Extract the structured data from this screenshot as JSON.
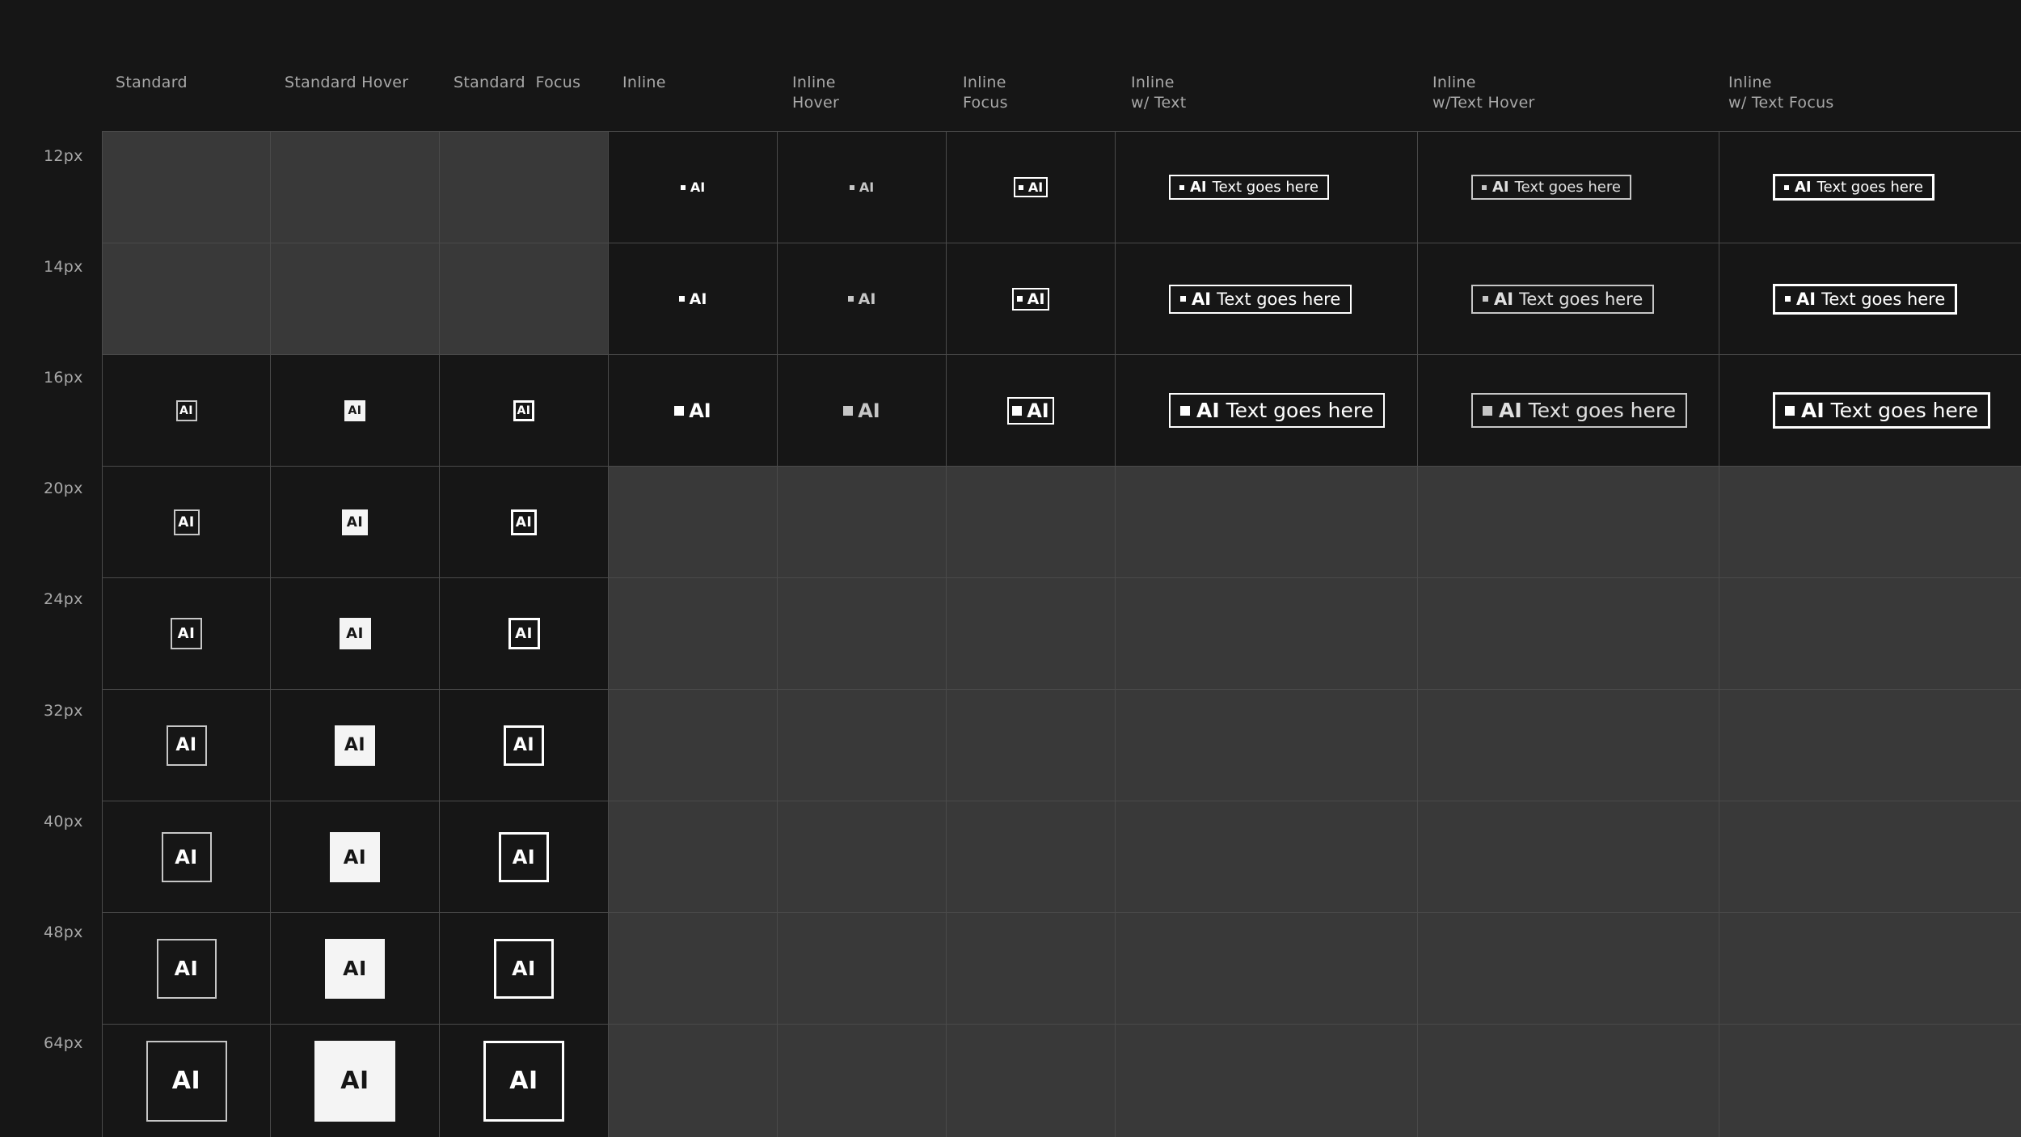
{
  "columns": {
    "standard": "Standard",
    "standard_hover": "Standard Hover",
    "standard_focus": "Standard  Focus",
    "inline": "Inline",
    "inline_hover": "Inline\nHover",
    "inline_focus": "Inline\nFocus",
    "inline_text": "Inline\nw/ Text",
    "inline_text_hover": "Inline\nw/Text Hover",
    "inline_text_focus": "Inline\nw/ Text Focus"
  },
  "rows": {
    "r12": "12px",
    "r14": "14px",
    "r16": "16px",
    "r20": "20px",
    "r24": "24px",
    "r32": "32px",
    "r40": "40px",
    "r48": "48px",
    "r64": "64px"
  },
  "label": {
    "ai": "AI",
    "text": "Text goes here"
  },
  "colors": {
    "background": "#161616",
    "empty_cell": "#393939",
    "grid_line": "#4a4a4a",
    "label_text": "#a8a8a8",
    "hover_fill": "#f4f4f4"
  }
}
